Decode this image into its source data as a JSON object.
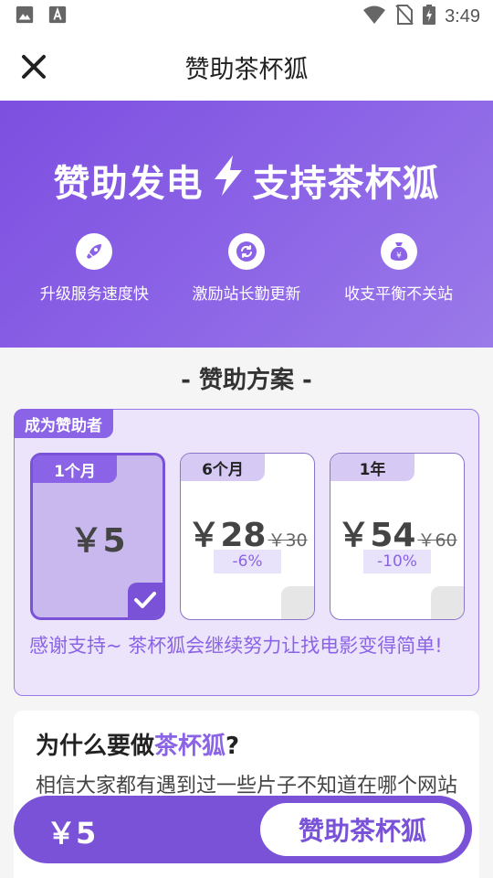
{
  "status_bar": {
    "time": "3:49"
  },
  "app_bar": {
    "title": "赞助茶杯狐"
  },
  "hero": {
    "title_left": "赞助发电",
    "title_right": "支持茶杯狐",
    "features": [
      {
        "label": "升级服务速度快",
        "icon": "rocket-icon"
      },
      {
        "label": "激励站长勤更新",
        "icon": "refresh-icon"
      },
      {
        "label": "收支平衡不关站",
        "icon": "money-bag-icon"
      }
    ]
  },
  "section_title": "- 赞助方案 -",
  "plans_card": {
    "tag": "成为赞助者",
    "plans": [
      {
        "period": "1个月",
        "price": "￥5",
        "original": "",
        "discount": "",
        "selected": true
      },
      {
        "period": "6个月",
        "price": "￥28",
        "original": "￥30",
        "discount": "-6%",
        "selected": false
      },
      {
        "period": "1年",
        "price": "￥54",
        "original": "￥60",
        "discount": "-10%",
        "selected": false
      }
    ],
    "thanks": "感谢支持~ 茶杯狐会继续努力让找电影变得简单!"
  },
  "why": {
    "title_prefix": "为什么要做",
    "title_accent": "茶杯狐",
    "title_suffix": "?",
    "text": "相信大家都有遇到过一些片子不知道在哪个网站可以看，茶杯狐就是为了解决这个问题，同步新线上影视资源的网站，让大家能更方"
  },
  "bottom_bar": {
    "price": "￥5",
    "button": "赞助茶杯狐"
  },
  "colors": {
    "accent": "#8b63e6",
    "accent_dark": "#7a52d8"
  }
}
